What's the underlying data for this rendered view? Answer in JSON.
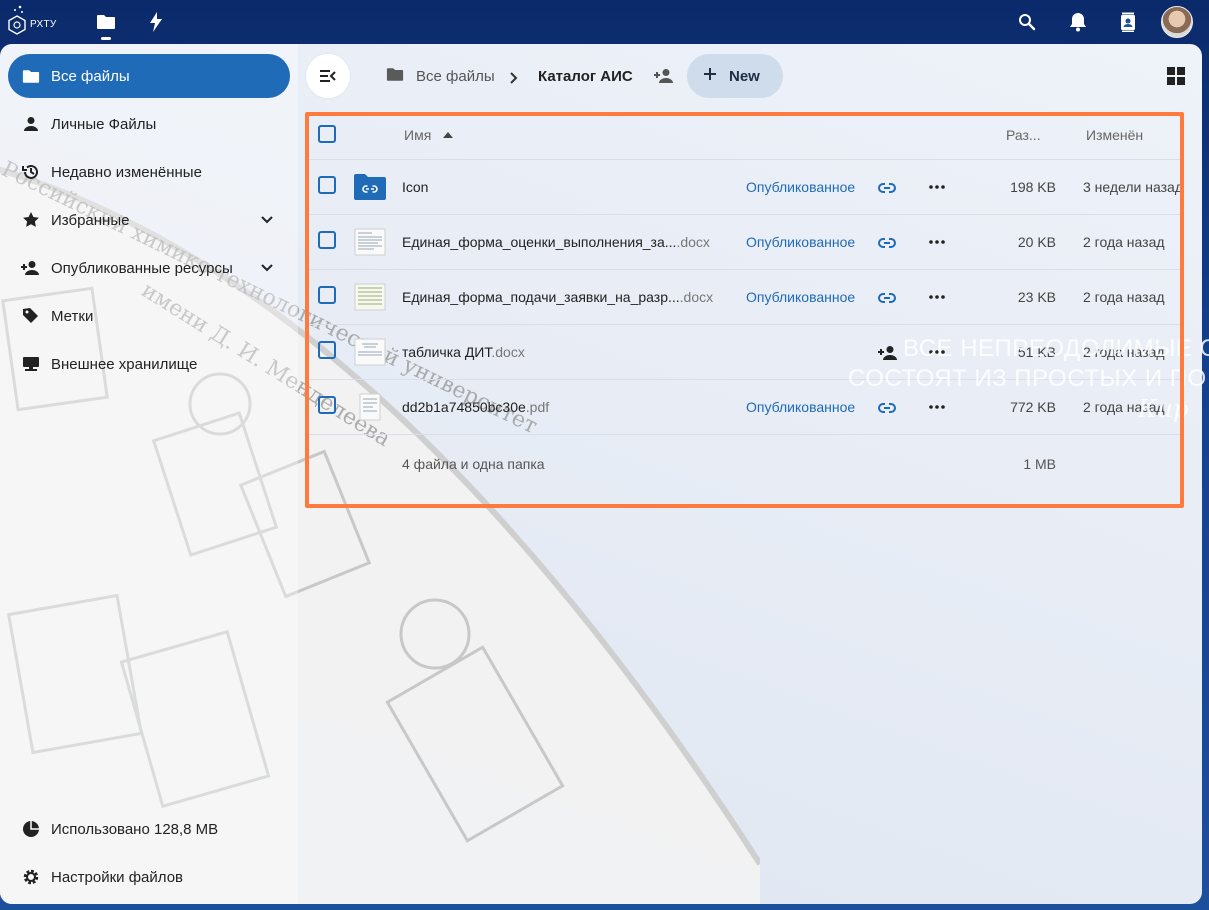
{
  "header": {
    "logo_text": "РХТУ",
    "apps": [
      {
        "name": "files-app",
        "icon": "folder-icon"
      },
      {
        "name": "activity-app",
        "icon": "lightning-icon"
      }
    ],
    "right_icons": [
      "search-icon",
      "bell-icon",
      "contacts-icon",
      "avatar"
    ]
  },
  "sidebar": {
    "items": [
      {
        "label": "Все файлы",
        "icon": "folder-icon",
        "active": true
      },
      {
        "label": "Личные Файлы",
        "icon": "user-icon"
      },
      {
        "label": "Недавно изменённые",
        "icon": "history-icon"
      },
      {
        "label": "Избранные",
        "icon": "star-icon",
        "expandable": true
      },
      {
        "label": "Опубликованные ресурсы",
        "icon": "share-user-icon",
        "expandable": true
      },
      {
        "label": "Метки",
        "icon": "tag-icon"
      },
      {
        "label": "Внешнее хранилище",
        "icon": "external-storage-icon"
      }
    ],
    "footer": {
      "quota_label": "Использовано 128,8 MB",
      "settings_label": "Настройки файлов"
    }
  },
  "breadcrumb": {
    "root": "Все файлы",
    "current": "Каталог АИС"
  },
  "toolbar": {
    "new_label": "New"
  },
  "table": {
    "columns": {
      "name": "Имя",
      "size": "Раз...",
      "modified": "Изменён"
    },
    "rows": [
      {
        "name": "Icon",
        "ext": "",
        "type": "folder",
        "shared_label": "Опубликованное",
        "size": "198 KB",
        "modified": "3 недели назад"
      },
      {
        "name": "Единая_форма_оценки_выполнения_за...",
        "ext": ".docx",
        "type": "doc",
        "shared_label": "Опубликованное",
        "size": "20 KB",
        "modified": "2 года назад"
      },
      {
        "name": "Единая_форма_подачи_заявки_на_разр...",
        "ext": ".docx",
        "type": "doc",
        "shared_label": "Опубликованное",
        "size": "23 KB",
        "modified": "2 года назад"
      },
      {
        "name": "табличка ДИТ",
        "ext": ".docx",
        "type": "doc",
        "shared_label": "",
        "size": "51 KB",
        "modified": "2 года назад"
      },
      {
        "name": "dd2b1a74850bc30e",
        "ext": ".pdf",
        "type": "pdf",
        "shared_label": "Опубликованное",
        "size": "772 KB",
        "modified": "2 года назад"
      }
    ],
    "footer": {
      "summary": "4 файла и одна папка",
      "total": "1 MB"
    }
  },
  "background_quote": {
    "line1": "ВСЕ НЕПРЕОДОЛИМЫЕ С",
    "line2": "СОСТОЯТ ИЗ ПРОСТЫХ И ПО",
    "line3": "Кир"
  },
  "background_image_text": {
    "line1": "Российский химико-технологический университет",
    "line2": "имени Д. И. Менделеева"
  },
  "colors": {
    "accent": "#1f6bb8",
    "highlight": "#ff7a3c",
    "header_bg": "#0b2a6b"
  }
}
